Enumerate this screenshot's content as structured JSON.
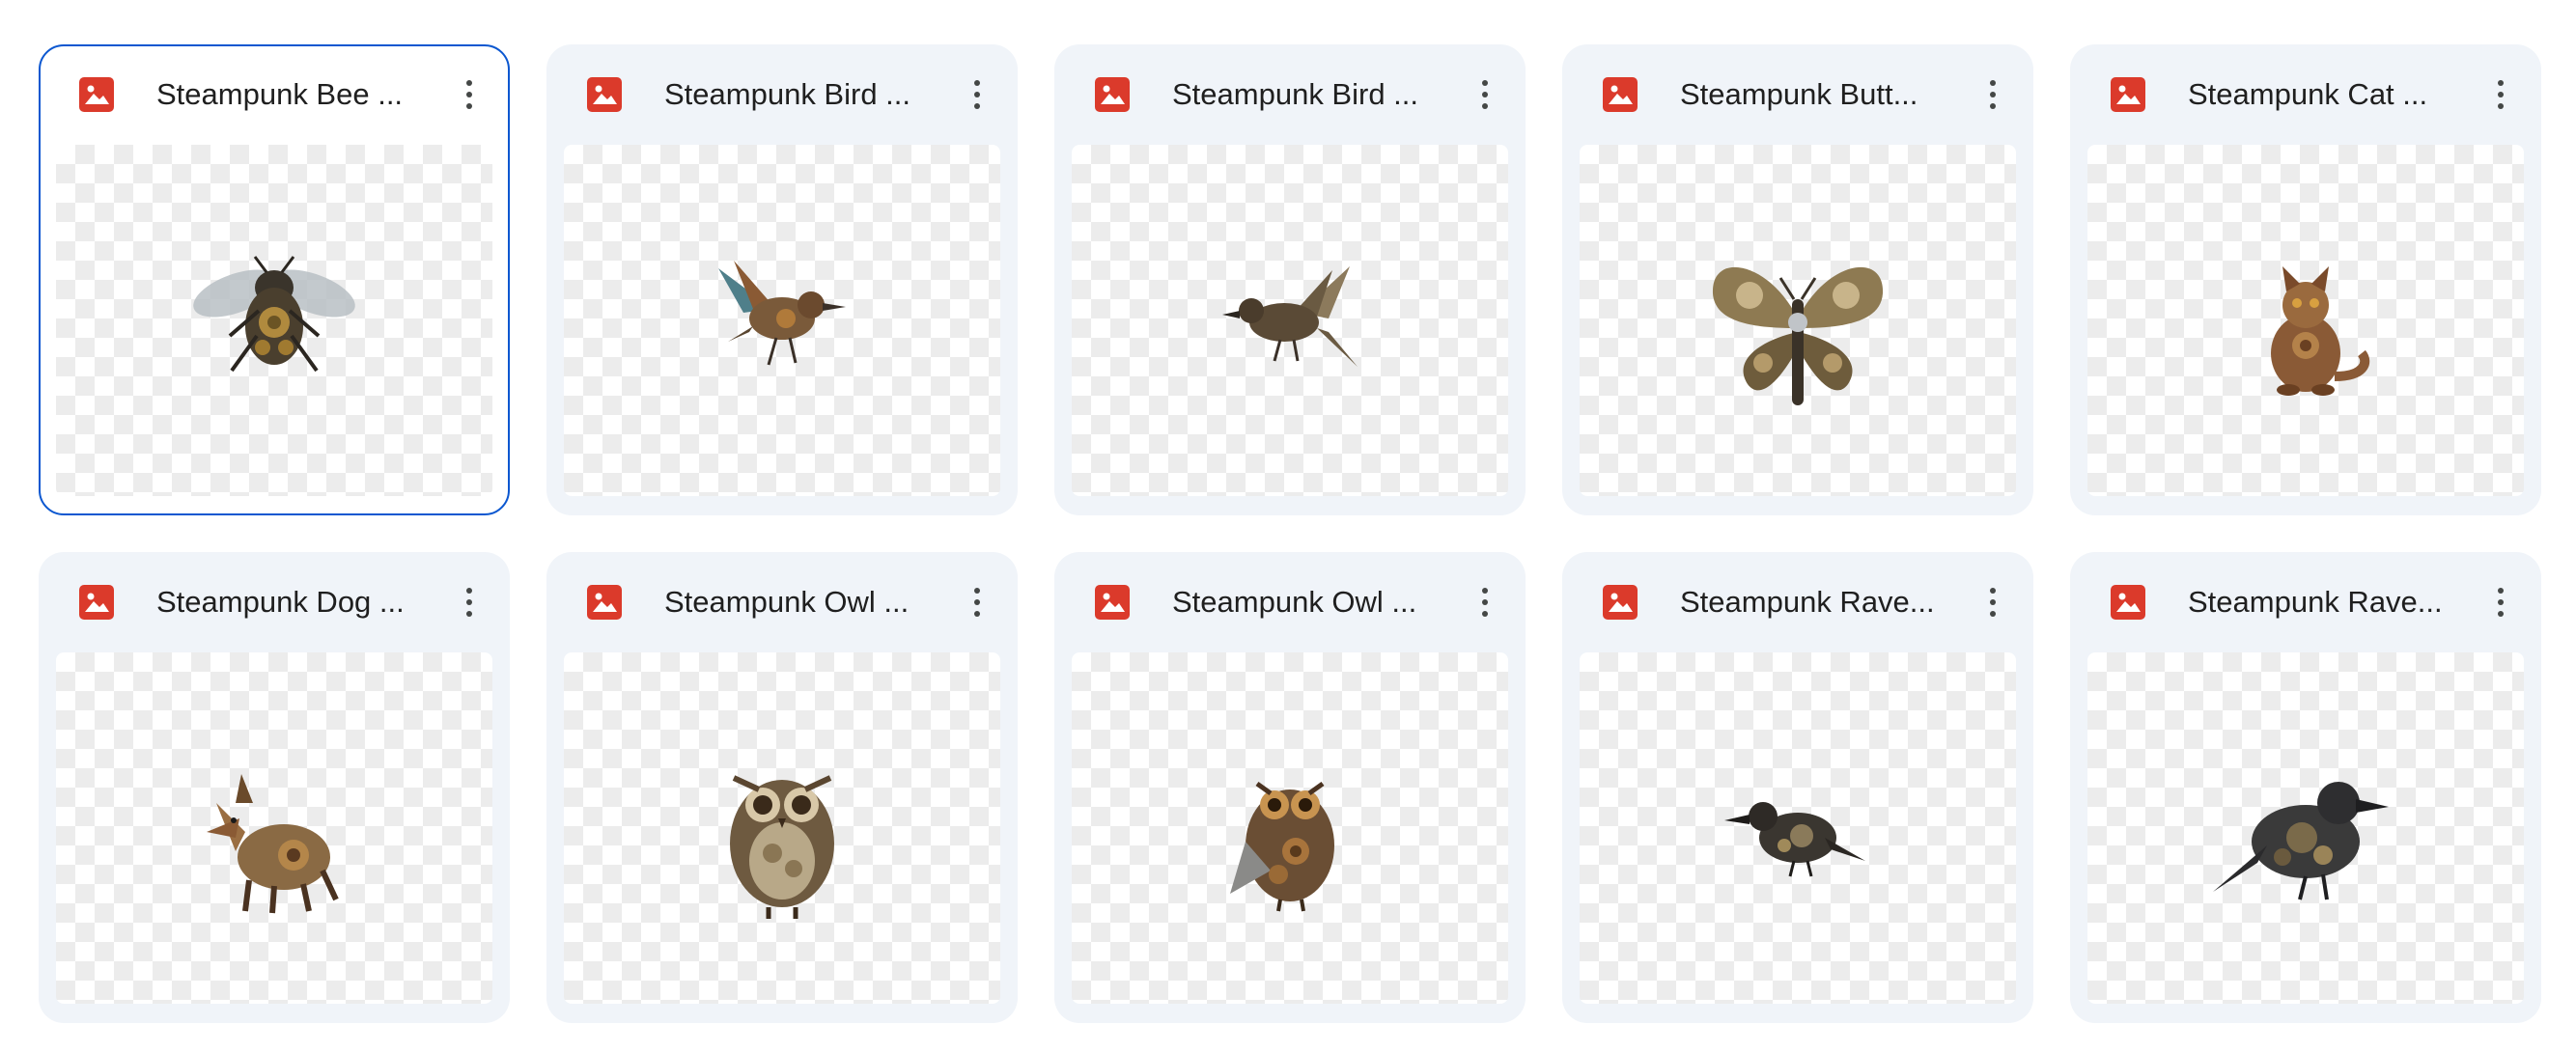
{
  "files": [
    {
      "title": "Steampunk Bee ...",
      "selected": true,
      "icon": "image-file-icon",
      "subject": "bee"
    },
    {
      "title": "Steampunk Bird ...",
      "selected": false,
      "icon": "image-file-icon",
      "subject": "bird-1"
    },
    {
      "title": "Steampunk Bird ...",
      "selected": false,
      "icon": "image-file-icon",
      "subject": "bird-2"
    },
    {
      "title": "Steampunk Butt...",
      "selected": false,
      "icon": "image-file-icon",
      "subject": "butterfly"
    },
    {
      "title": "Steampunk Cat ...",
      "selected": false,
      "icon": "image-file-icon",
      "subject": "cat"
    },
    {
      "title": "Steampunk Dog ...",
      "selected": false,
      "icon": "image-file-icon",
      "subject": "dog"
    },
    {
      "title": "Steampunk Owl ...",
      "selected": false,
      "icon": "image-file-icon",
      "subject": "owl-1"
    },
    {
      "title": "Steampunk Owl ...",
      "selected": false,
      "icon": "image-file-icon",
      "subject": "owl-2"
    },
    {
      "title": "Steampunk Rave...",
      "selected": false,
      "icon": "image-file-icon",
      "subject": "raven-1"
    },
    {
      "title": "Steampunk Rave...",
      "selected": false,
      "icon": "image-file-icon",
      "subject": "raven-2"
    }
  ],
  "colors": {
    "card_bg": "#f0f4f9",
    "selected_border": "#0b57d0",
    "image_icon": "#db3a2b",
    "text": "#1f1f1f"
  }
}
